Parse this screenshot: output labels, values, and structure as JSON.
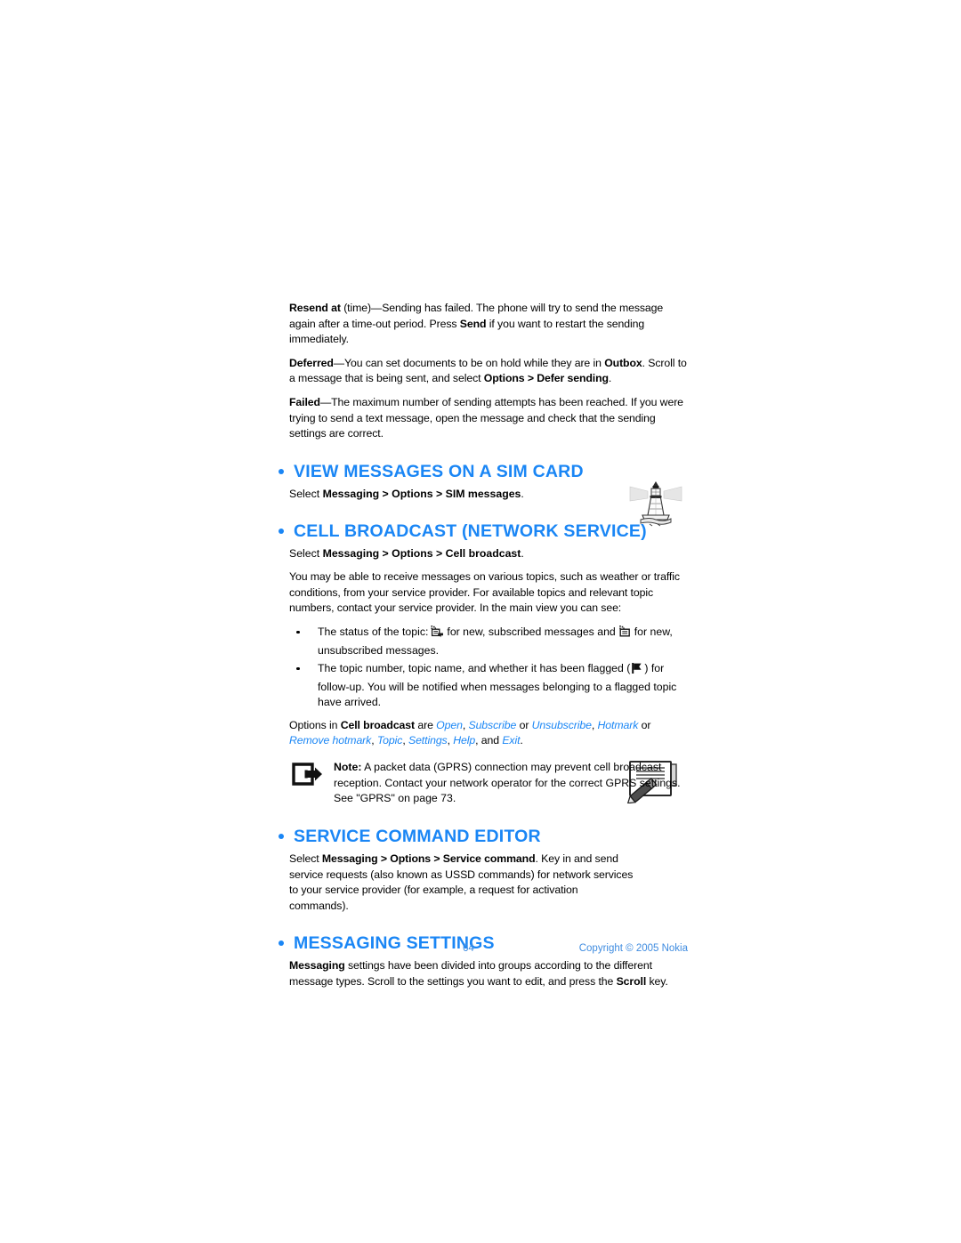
{
  "document": {
    "page_number": "64",
    "copyright": "Copyright © 2005 Nokia",
    "accent_color": "#1a86f5",
    "footer_color": "#3f8ce0"
  },
  "intro_paragraphs": [
    {
      "id": "resend-at",
      "term": "Resend at",
      "text": " (time)—Sending has failed. The phone will try to send the message again after a time-out period. Press ",
      "bold2": "Send",
      "text2": " if you want to restart the sending immediately."
    },
    {
      "id": "deferred",
      "term": "Deferred",
      "text": "—You can set documents to be on hold while they are in ",
      "bold2": "Outbox",
      "text2": ". Scroll to a message that is being sent, and select ",
      "bold3": "Options > Defer sending",
      "text3": "."
    },
    {
      "id": "failed",
      "term": "Failed",
      "text": "—The maximum number of sending attempts has been reached. If you were trying to send a text message, open the message and check that the sending settings are correct."
    }
  ],
  "sections": {
    "view_sim": {
      "heading": "VIEW MESSAGES ON A SIM CARD",
      "select_prefix": "Select ",
      "select_path": "Messaging > Options > SIM messages",
      "select_suffix": "."
    },
    "cell_broadcast": {
      "heading": "CELL BROADCAST (NETWORK SERVICE)",
      "select_prefix": "Select ",
      "select_path": "Messaging > Options > Cell broadcast",
      "select_suffix": ".",
      "icon_name": "lighthouse-icon",
      "body": "You may be able to receive messages on various topics, such as weather or traffic conditions, from your service provider. For available topics and relevant topic numbers, contact your service provider. In the main view you can see:",
      "bullets": [
        {
          "part1": "The status of the topic:",
          "icon1": "new-subscribed-message-icon",
          "part2": "for new, subscribed messages and",
          "icon2": "new-unsubscribed-message-icon",
          "part3": "for new, unsubscribed messages."
        },
        {
          "part1": "The topic number, topic name, and whether it has been flagged (",
          "icon1": "flag-icon",
          "part2": ") for follow-up. You will be notified when messages belonging to a flagged topic have arrived."
        }
      ],
      "options_line": {
        "prefix": "Options in ",
        "bold": "Cell broadcast",
        "are": " are ",
        "items": [
          "Open",
          "Subscribe",
          "Unsubscribe",
          "Hotmark",
          "Remove hotmark",
          "Topic",
          "Settings",
          "Help",
          "Exit"
        ],
        "sep1": ", ",
        "sep_or": " or ",
        "sep_and": ", and ",
        "end": "."
      },
      "note": {
        "icon_name": "note-arrow-icon",
        "label": "Note:",
        "text": " A packet data (GPRS) connection may prevent cell broadcast reception. Contact your network operator for the correct GPRS settings. See \"GPRS\" on page 73."
      }
    },
    "service_command": {
      "heading": "SERVICE COMMAND EDITOR",
      "icon_name": "service-command-editor-icon",
      "select_prefix": "Select ",
      "select_path": "Messaging > Options > Service command",
      "body": ". Key in and send service requests (also known as USSD commands) for network services to your service provider (for example, a request for activation commands)."
    },
    "messaging_settings": {
      "heading": "MESSAGING SETTINGS",
      "bold1": "Messaging",
      "text1": " settings have been divided into groups according to the different message types. Scroll to the settings you want to edit, and press the ",
      "bold2": "Scroll",
      "text2": " key."
    }
  }
}
